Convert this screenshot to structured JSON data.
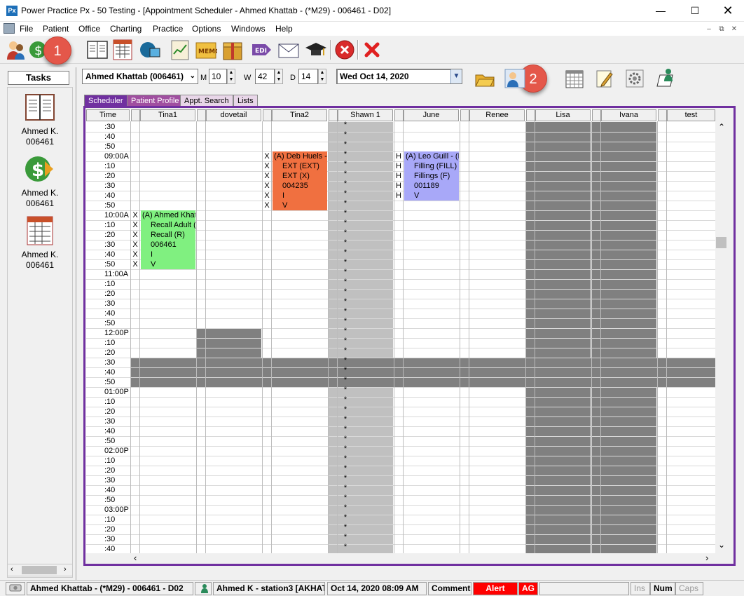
{
  "window": {
    "app_icon": "Px",
    "title": "Power Practice Px - 50 Testing - [Appointment Scheduler - Ahmed Khattab - (*M29) - 006461 - D02]"
  },
  "menu": [
    "File",
    "Patient",
    "Office",
    "Charting",
    "Practice",
    "Options",
    "Windows",
    "Help"
  ],
  "toolbar_icons": [
    "patients-icon",
    "money-icon",
    "scheduler-book-icon",
    "chart-icon",
    "imaging-icon",
    "clipboard-icon",
    "memo-icon",
    "package-icon",
    "edi-icon",
    "mail-icon",
    "graduation-icon",
    "close-circle-icon",
    "red-x-icon"
  ],
  "callouts": {
    "one": "1",
    "two": "2"
  },
  "tasks": {
    "title": "Tasks",
    "items": [
      {
        "icon": "book-icon",
        "name": "Ahmed K.",
        "id": "006461"
      },
      {
        "icon": "money-icon",
        "name": "Ahmed K.",
        "id": "006461"
      },
      {
        "icon": "chart-icon",
        "name": "Ahmed K.",
        "id": "006461"
      }
    ]
  },
  "controls": {
    "patient": "Ahmed Khattab (006461)",
    "m_label": "M",
    "m_value": "10",
    "w_label": "W",
    "w_value": "42",
    "d_label": "D",
    "d_value": "14",
    "date": "Wed  Oct 14, 2020"
  },
  "tabs": [
    "Scheduler",
    "Patient Profile",
    "Appt. Search",
    "Lists"
  ],
  "columns": [
    "Time",
    "Tina1",
    "dovetail",
    "Tina2",
    "Shawn 1",
    "June",
    "Renee",
    "Lisa",
    "Ivana",
    "test"
  ],
  "times": [
    ":30",
    ":40",
    ":50",
    "09:00A",
    ":10",
    ":20",
    ":30",
    ":40",
    ":50",
    "10:00A",
    ":10",
    ":20",
    ":30",
    ":40",
    ":50",
    "11:00A",
    ":10",
    ":20",
    ":30",
    ":40",
    ":50",
    "12:00P",
    ":10",
    ":20",
    ":30",
    ":40",
    ":50",
    "01:00P",
    ":10",
    ":20",
    ":30",
    ":40",
    ":50",
    "02:00P",
    ":10",
    ":20",
    ":30",
    ":40",
    ":50",
    "03:00P",
    ":10",
    ":20",
    ":30",
    ":40"
  ],
  "appointments": {
    "tina1": {
      "mark": "X",
      "lines": [
        "(A) Ahmed Khat",
        "Recall Adult (",
        "Recall (R)",
        "006461",
        "I",
        "V"
      ],
      "color": "#80f080"
    },
    "tina2": {
      "mark": "X",
      "lines": [
        "(A) Deb Huels -",
        "EXT (EXT)",
        "EXT (X)",
        "004235",
        "I",
        "V"
      ],
      "color": "#f07040"
    },
    "june": {
      "mark": "H",
      "lines": [
        "(A) Leo Guill - (H",
        "Filling (FILL)",
        "Fillings (F)",
        "001189",
        "V"
      ],
      "color": "#a8a8f8"
    }
  },
  "shawn_mark": "*",
  "status": {
    "patient": "Ahmed Khattab - (*M29) - 006461 - D02",
    "station": "Ahmed K - station3 [AKHAT",
    "datetime": "Oct 14, 2020 08:09 AM",
    "comment": "Comment",
    "alert": "Alert",
    "ag": "AG",
    "ins": "Ins",
    "num": "Num",
    "caps": "Caps"
  },
  "colors": {
    "accent": "#7030a0",
    "alert": "#ff0000",
    "blocked": "#808080",
    "shawn": "#c0c0c0",
    "callout": "#e4574a"
  }
}
